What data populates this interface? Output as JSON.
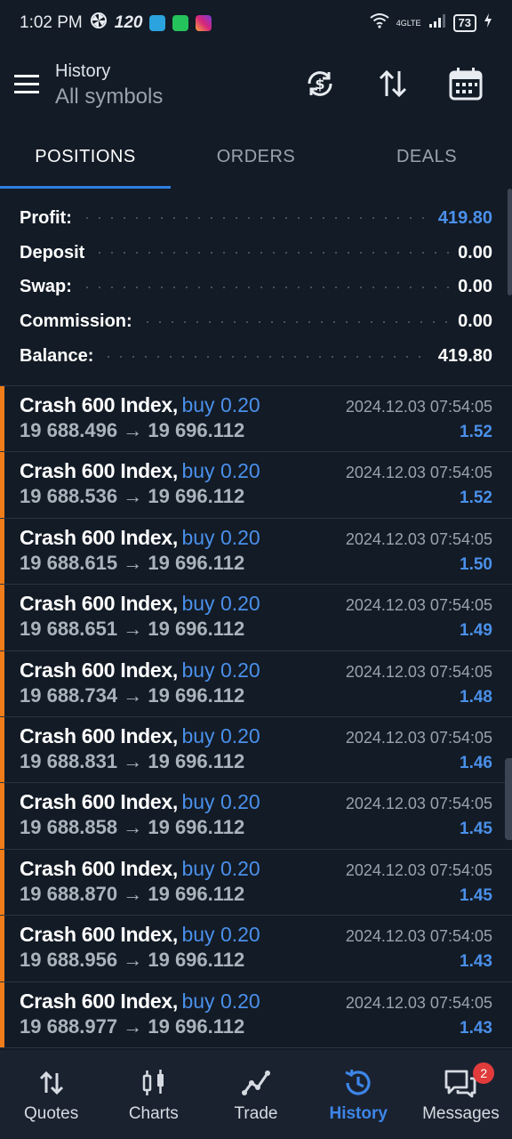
{
  "status_bar": {
    "time": "1:02 PM",
    "refresh_rate": "120",
    "network": "4GLTE",
    "battery": "73",
    "app_icons": [
      "telegram-icon",
      "whatsapp-icon",
      "instagram-icon"
    ]
  },
  "header": {
    "title": "History",
    "subtitle": "All symbols",
    "icons": [
      "menu-icon",
      "currency-sync-icon",
      "sort-icon",
      "calendar-icon"
    ]
  },
  "tabs": [
    {
      "label": "POSITIONS",
      "active": true
    },
    {
      "label": "ORDERS",
      "active": false
    },
    {
      "label": "DEALS",
      "active": false
    }
  ],
  "summary": [
    {
      "label": "Profit:",
      "value": "419.80",
      "highlight": true
    },
    {
      "label": "Deposit",
      "value": "0.00",
      "highlight": false
    },
    {
      "label": "Swap:",
      "value": "0.00",
      "highlight": false
    },
    {
      "label": "Commission:",
      "value": "0.00",
      "highlight": false
    },
    {
      "label": "Balance:",
      "value": "419.80",
      "highlight": false
    }
  ],
  "deals": [
    {
      "symbol": "Crash 600 Index,",
      "side": "buy 0.20",
      "time": "2024.12.03 07:54:05",
      "open": "19 688.496",
      "arrow": "→",
      "close": "19 696.112",
      "profit": "1.52"
    },
    {
      "symbol": "Crash 600 Index,",
      "side": "buy 0.20",
      "time": "2024.12.03 07:54:05",
      "open": "19 688.536",
      "arrow": "→",
      "close": "19 696.112",
      "profit": "1.52"
    },
    {
      "symbol": "Crash 600 Index,",
      "side": "buy 0.20",
      "time": "2024.12.03 07:54:05",
      "open": "19 688.615",
      "arrow": "→",
      "close": "19 696.112",
      "profit": "1.50"
    },
    {
      "symbol": "Crash 600 Index,",
      "side": "buy 0.20",
      "time": "2024.12.03 07:54:05",
      "open": "19 688.651",
      "arrow": "→",
      "close": "19 696.112",
      "profit": "1.49"
    },
    {
      "symbol": "Crash 600 Index,",
      "side": "buy 0.20",
      "time": "2024.12.03 07:54:05",
      "open": "19 688.734",
      "arrow": "→",
      "close": "19 696.112",
      "profit": "1.48"
    },
    {
      "symbol": "Crash 600 Index,",
      "side": "buy 0.20",
      "time": "2024.12.03 07:54:05",
      "open": "19 688.831",
      "arrow": "→",
      "close": "19 696.112",
      "profit": "1.46"
    },
    {
      "symbol": "Crash 600 Index,",
      "side": "buy 0.20",
      "time": "2024.12.03 07:54:05",
      "open": "19 688.858",
      "arrow": "→",
      "close": "19 696.112",
      "profit": "1.45"
    },
    {
      "symbol": "Crash 600 Index,",
      "side": "buy 0.20",
      "time": "2024.12.03 07:54:05",
      "open": "19 688.870",
      "arrow": "→",
      "close": "19 696.112",
      "profit": "1.45"
    },
    {
      "symbol": "Crash 600 Index,",
      "side": "buy 0.20",
      "time": "2024.12.03 07:54:05",
      "open": "19 688.956",
      "arrow": "→",
      "close": "19 696.112",
      "profit": "1.43"
    },
    {
      "symbol": "Crash 600 Index,",
      "side": "buy 0.20",
      "time": "2024.12.03 07:54:05",
      "open": "19 688.977",
      "arrow": "→",
      "close": "19 696.112",
      "profit": "1.43"
    }
  ],
  "bottom_nav": [
    {
      "label": "Quotes",
      "icon": "quotes-icon",
      "active": false
    },
    {
      "label": "Charts",
      "icon": "charts-icon",
      "active": false
    },
    {
      "label": "Trade",
      "icon": "trade-icon",
      "active": false
    },
    {
      "label": "History",
      "icon": "history-icon",
      "active": true
    },
    {
      "label": "Messages",
      "icon": "messages-icon",
      "active": false,
      "badge": "2"
    }
  ],
  "colors": {
    "background": "#131b26",
    "accent_blue": "#4a90ea",
    "nav_active": "#3d86e8",
    "position_marker": "#f07d1a",
    "badge": "#e23b3b"
  }
}
